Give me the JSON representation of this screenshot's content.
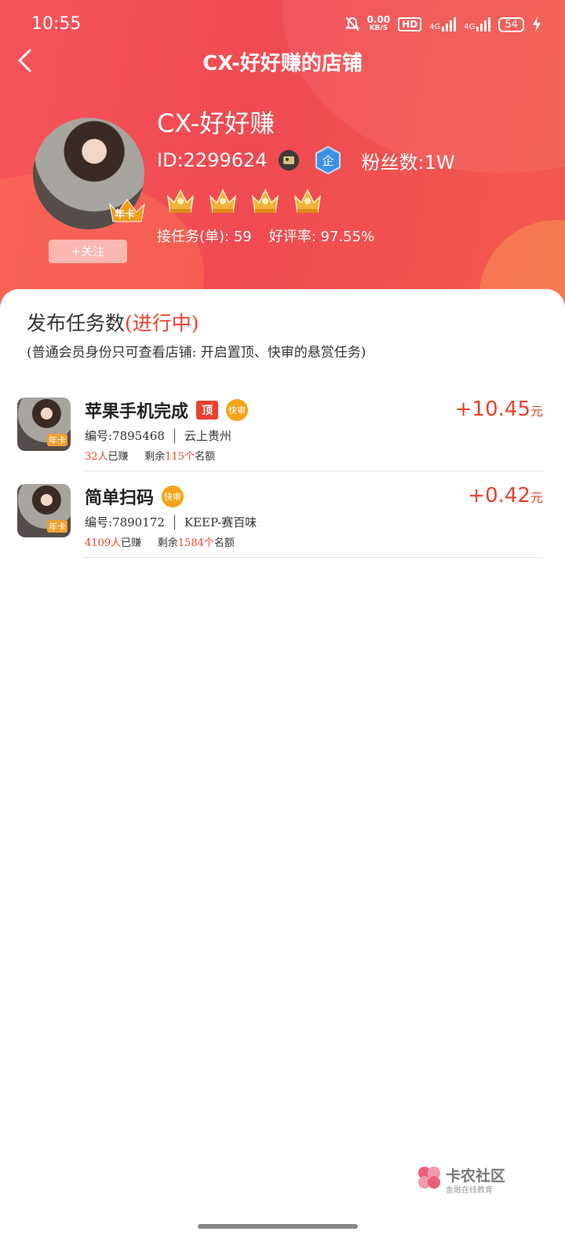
{
  "status_bar": {
    "time": "10:55",
    "net_speed_value": "0.00",
    "net_speed_unit": "KB/S",
    "hd_label": "HD",
    "signal1_label": "4G",
    "signal2_label": "4G",
    "battery": "54"
  },
  "nav": {
    "title": "CX-好好赚的店铺"
  },
  "profile": {
    "shop_name": "CX-好好赚",
    "id_text": "ID:2299624",
    "fans_text": "粉丝数:1W",
    "enterprise_label": "企",
    "year_card_label": "年卡",
    "follow_label": "+关注",
    "tasks_taken_text": "接任务(单): 59",
    "rating_text": "好评率: 97.55%",
    "crown_count": 4
  },
  "section": {
    "title": "发布任务数",
    "status": "(进行中)",
    "note": "(普通会员身份只可查看店铺: 开启置顶、快审的悬赏任务)"
  },
  "tasks": [
    {
      "name": "苹果手机完成",
      "top_tag": "顶",
      "fast_tag": "快审",
      "code": "编号:7895468",
      "category": "云上贵州",
      "earned_count": "32人",
      "earned_suffix": "已赚",
      "remain_prefix": "剩余",
      "remain_count": "115个",
      "remain_suffix": "名额",
      "reward": "+10.45",
      "unit": "元",
      "thumb_badge": "年卡"
    },
    {
      "name": "简单扫码",
      "fast_tag": "快审",
      "code": "编号:7890172",
      "category": "KEEP-赛百味",
      "earned_count": "4109人",
      "earned_suffix": "已赚",
      "remain_prefix": "剩余",
      "remain_count": "1584个",
      "remain_suffix": "名额",
      "reward": "+0.42",
      "unit": "元",
      "thumb_badge": "年卡"
    }
  ],
  "watermark": {
    "title": "卡农社区",
    "subtitle": "金融在线教育"
  },
  "colors": {
    "header_red": "#f04a52",
    "accent_red": "#e8412f",
    "fast_badge": "#f4a419"
  }
}
